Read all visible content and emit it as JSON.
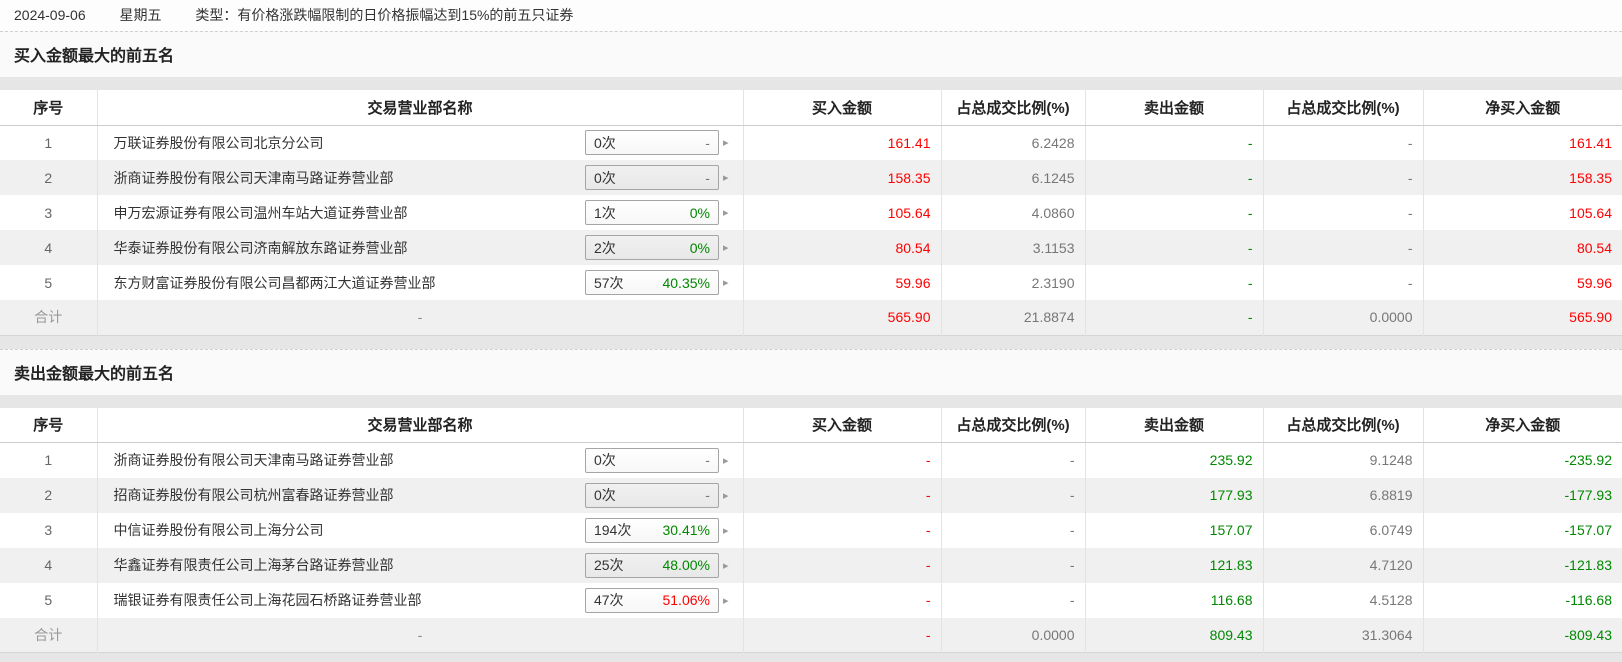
{
  "meta": {
    "date": "2024-09-06",
    "weekday": "星期五",
    "type_label": "类型：",
    "type_text": "有价格涨跌幅限制的日价格振幅达到15%的前五只证券"
  },
  "colors": {
    "up": "#ff0000",
    "down": "#008800"
  },
  "columns": [
    "序号",
    "交易营业部名称",
    "买入金额",
    "占总成交比例(%)",
    "卖出金额",
    "占总成交比例(%)",
    "净买入金额"
  ],
  "tables": [
    {
      "title": "买入金额最大的前五名",
      "rows": [
        {
          "no": "1",
          "name": "万联证券股份有限公司北京分公司",
          "badge": {
            "count": "0次",
            "value": "-",
            "color": "gray"
          },
          "cells": [
            {
              "t": "161.41",
              "c": "red"
            },
            {
              "t": "6.2428",
              "c": "gray"
            },
            {
              "t": "-",
              "c": "green"
            },
            {
              "t": "-",
              "c": "gray"
            },
            {
              "t": "161.41",
              "c": "red"
            }
          ]
        },
        {
          "no": "2",
          "name": "浙商证券股份有限公司天津南马路证券营业部",
          "badge": {
            "count": "0次",
            "value": "-",
            "color": "gray"
          },
          "cells": [
            {
              "t": "158.35",
              "c": "red"
            },
            {
              "t": "6.1245",
              "c": "gray"
            },
            {
              "t": "-",
              "c": "green"
            },
            {
              "t": "-",
              "c": "gray"
            },
            {
              "t": "158.35",
              "c": "red"
            }
          ]
        },
        {
          "no": "3",
          "name": "申万宏源证券有限公司温州车站大道证券营业部",
          "badge": {
            "count": "1次",
            "value": "0%",
            "color": "green"
          },
          "cells": [
            {
              "t": "105.64",
              "c": "red"
            },
            {
              "t": "4.0860",
              "c": "gray"
            },
            {
              "t": "-",
              "c": "green"
            },
            {
              "t": "-",
              "c": "gray"
            },
            {
              "t": "105.64",
              "c": "red"
            }
          ]
        },
        {
          "no": "4",
          "name": "华泰证券股份有限公司济南解放东路证券营业部",
          "badge": {
            "count": "2次",
            "value": "0%",
            "color": "green"
          },
          "cells": [
            {
              "t": "80.54",
              "c": "red"
            },
            {
              "t": "3.1153",
              "c": "gray"
            },
            {
              "t": "-",
              "c": "green"
            },
            {
              "t": "-",
              "c": "gray"
            },
            {
              "t": "80.54",
              "c": "red"
            }
          ]
        },
        {
          "no": "5",
          "name": "东方财富证券股份有限公司昌都两江大道证券营业部",
          "badge": {
            "count": "57次",
            "value": "40.35%",
            "color": "green"
          },
          "cells": [
            {
              "t": "59.96",
              "c": "red"
            },
            {
              "t": "2.3190",
              "c": "gray"
            },
            {
              "t": "-",
              "c": "green"
            },
            {
              "t": "-",
              "c": "gray"
            },
            {
              "t": "59.96",
              "c": "red"
            }
          ]
        }
      ],
      "total": {
        "no": "合计",
        "name": "-",
        "cells": [
          {
            "t": "565.90",
            "c": "red"
          },
          {
            "t": "21.8874",
            "c": "gray"
          },
          {
            "t": "-",
            "c": "green"
          },
          {
            "t": "0.0000",
            "c": "gray"
          },
          {
            "t": "565.90",
            "c": "red"
          }
        ]
      }
    },
    {
      "title": "卖出金额最大的前五名",
      "rows": [
        {
          "no": "1",
          "name": "浙商证券股份有限公司天津南马路证券营业部",
          "badge": {
            "count": "0次",
            "value": "-",
            "color": "gray"
          },
          "cells": [
            {
              "t": "-",
              "c": "red"
            },
            {
              "t": "-",
              "c": "gray"
            },
            {
              "t": "235.92",
              "c": "green"
            },
            {
              "t": "9.1248",
              "c": "gray"
            },
            {
              "t": "-235.92",
              "c": "green"
            }
          ]
        },
        {
          "no": "2",
          "name": "招商证券股份有限公司杭州富春路证券营业部",
          "badge": {
            "count": "0次",
            "value": "-",
            "color": "gray"
          },
          "cells": [
            {
              "t": "-",
              "c": "red"
            },
            {
              "t": "-",
              "c": "gray"
            },
            {
              "t": "177.93",
              "c": "green"
            },
            {
              "t": "6.8819",
              "c": "gray"
            },
            {
              "t": "-177.93",
              "c": "green"
            }
          ]
        },
        {
          "no": "3",
          "name": "中信证券股份有限公司上海分公司",
          "badge": {
            "count": "194次",
            "value": "30.41%",
            "color": "green"
          },
          "cells": [
            {
              "t": "-",
              "c": "red"
            },
            {
              "t": "-",
              "c": "gray"
            },
            {
              "t": "157.07",
              "c": "green"
            },
            {
              "t": "6.0749",
              "c": "gray"
            },
            {
              "t": "-157.07",
              "c": "green"
            }
          ]
        },
        {
          "no": "4",
          "name": "华鑫证券有限责任公司上海茅台路证券营业部",
          "badge": {
            "count": "25次",
            "value": "48.00%",
            "color": "green"
          },
          "cells": [
            {
              "t": "-",
              "c": "red"
            },
            {
              "t": "-",
              "c": "gray"
            },
            {
              "t": "121.83",
              "c": "green"
            },
            {
              "t": "4.7120",
              "c": "gray"
            },
            {
              "t": "-121.83",
              "c": "green"
            }
          ]
        },
        {
          "no": "5",
          "name": "瑞银证券有限责任公司上海花园石桥路证券营业部",
          "badge": {
            "count": "47次",
            "value": "51.06%",
            "color": "red"
          },
          "cells": [
            {
              "t": "-",
              "c": "red"
            },
            {
              "t": "-",
              "c": "gray"
            },
            {
              "t": "116.68",
              "c": "green"
            },
            {
              "t": "4.5128",
              "c": "gray"
            },
            {
              "t": "-116.68",
              "c": "green"
            }
          ]
        }
      ],
      "total": {
        "no": "合计",
        "name": "-",
        "cells": [
          {
            "t": "-",
            "c": "red"
          },
          {
            "t": "0.0000",
            "c": "gray"
          },
          {
            "t": "809.43",
            "c": "green"
          },
          {
            "t": "31.3064",
            "c": "gray"
          },
          {
            "t": "-809.43",
            "c": "green"
          }
        ]
      }
    }
  ]
}
